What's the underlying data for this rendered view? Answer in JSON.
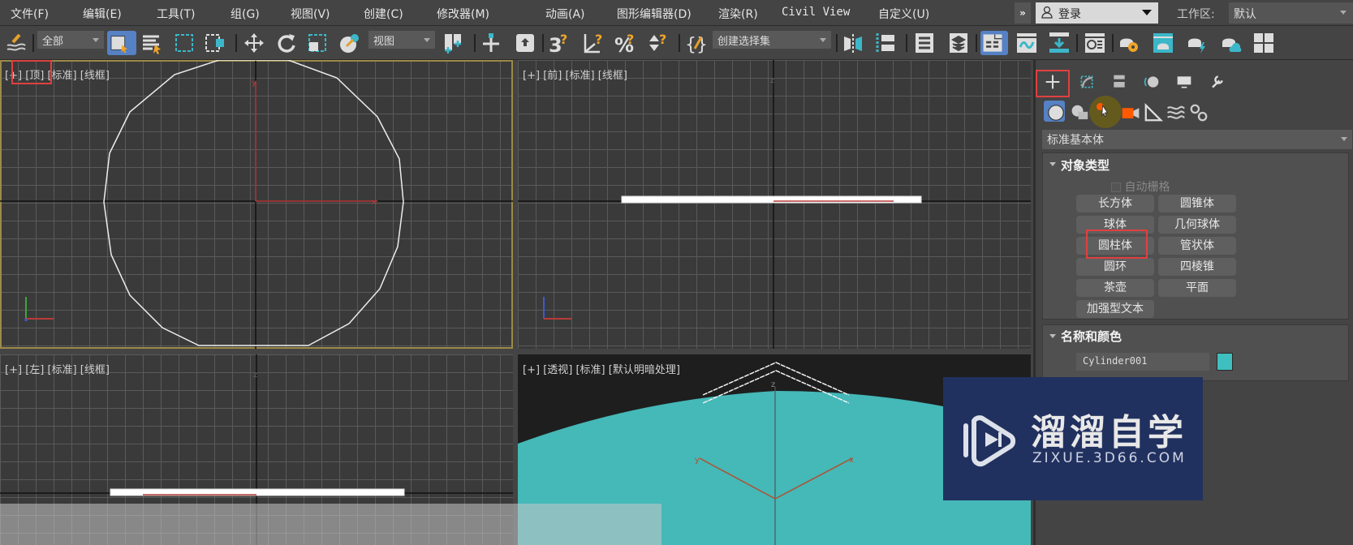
{
  "menubar": {
    "items": [
      "文件(F)",
      "编辑(E)",
      "工具(T)",
      "组(G)",
      "视图(V)",
      "创建(C)",
      "修改器(M)",
      "动画(A)",
      "图形编辑器(D)",
      "渲染(R)",
      "Civil View",
      "自定义(U)"
    ],
    "overflow": "»",
    "login": "登录",
    "workspace_label": "工作区:",
    "workspace_value": "默认"
  },
  "toolbar": {
    "filter_dropdown": "全部",
    "coord_dropdown": "视图",
    "selection_set_dropdown": "创建选择集",
    "icons": [
      "link-icon",
      "select-object-icon",
      "select-by-name-icon",
      "rect-region-icon",
      "window-crossing-icon",
      "move-icon",
      "rotate-icon",
      "scale-icon",
      "pivot-icon",
      "select-manipulate-icon",
      "keyboard-shortcut-icon",
      "snap-3d-icon",
      "angle-snap-icon",
      "percent-snap-icon",
      "spinner-snap-icon",
      "edit-named-sets-icon",
      "mirror-icon",
      "align-icon",
      "scene-explorer-icon",
      "layer-explorer-icon",
      "toggle-ribbon-icon",
      "curve-editor-icon",
      "schematic-view-icon",
      "material-editor-icon",
      "render-setup-icon",
      "rendered-frame-icon",
      "render-icon",
      "render-cloud-icon",
      "viewport-layouts-icon"
    ]
  },
  "viewports": {
    "top": {
      "labels": [
        "[+]",
        "[顶]",
        "[标准]",
        "[线框]"
      ]
    },
    "front": {
      "labels": [
        "[+]",
        "[前]",
        "[标准]",
        "[线框]"
      ]
    },
    "left": {
      "labels": [
        "[+]",
        "[左]",
        "[标准]",
        "[线框]"
      ]
    },
    "perspective": {
      "labels": [
        "[+]",
        "[透视]",
        "[标准]",
        "[默认明暗处理]"
      ]
    },
    "axis_labels": {
      "x": "x",
      "y": "y",
      "z": "z"
    }
  },
  "command_panel": {
    "tabs": [
      "create-tab",
      "modify-tab",
      "hierarchy-tab",
      "motion-tab",
      "display-tab",
      "utilities-tab"
    ],
    "categories": [
      "geometry",
      "shapes",
      "lights",
      "cameras",
      "helpers",
      "space-warps",
      "systems"
    ],
    "subcategory": "标准基本体",
    "object_type": {
      "title": "对象类型",
      "autogrid": "自动栅格",
      "buttons": [
        "长方体",
        "圆锥体",
        "球体",
        "几何球体",
        "圆柱体",
        "管状体",
        "圆环",
        "四棱锥",
        "茶壶",
        "平面",
        "加强型文本"
      ]
    },
    "name_color": {
      "title": "名称和颜色",
      "name_value": "Cylinder001",
      "color": "#3fbfbf"
    }
  },
  "watermark": {
    "title": "溜溜自学",
    "url": "ZIXUE.3D66.COM"
  },
  "colors": {
    "accent_selected": "#5681c4",
    "highlight_box": "#e04040",
    "object_color": "#45b8b8",
    "active_viewport_border": "#9b8a48"
  }
}
